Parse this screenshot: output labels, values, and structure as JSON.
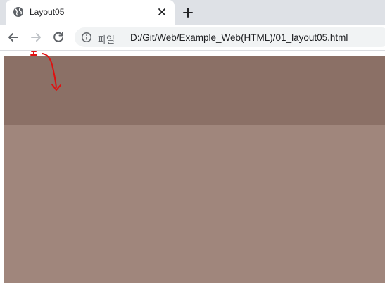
{
  "browser": {
    "tab": {
      "title": "Layout05",
      "favicon_icon": "globe-icon",
      "close_icon": "close-icon"
    },
    "new_tab_icon": "plus-icon",
    "toolbar": {
      "back_icon": "arrow-left-icon",
      "forward_icon": "arrow-right-icon",
      "reload_icon": "reload-icon",
      "info_icon": "info-icon",
      "origin_label": "파일",
      "url": "D:/Git/Web/Example_Web(HTML)/01_layout05.html"
    }
  },
  "page": {
    "header_color": "#8b7066",
    "content_color": "#a0867c",
    "annotation": {
      "shape": "red hand-drawn curved arrow pointing down",
      "color": "#e01010"
    }
  }
}
